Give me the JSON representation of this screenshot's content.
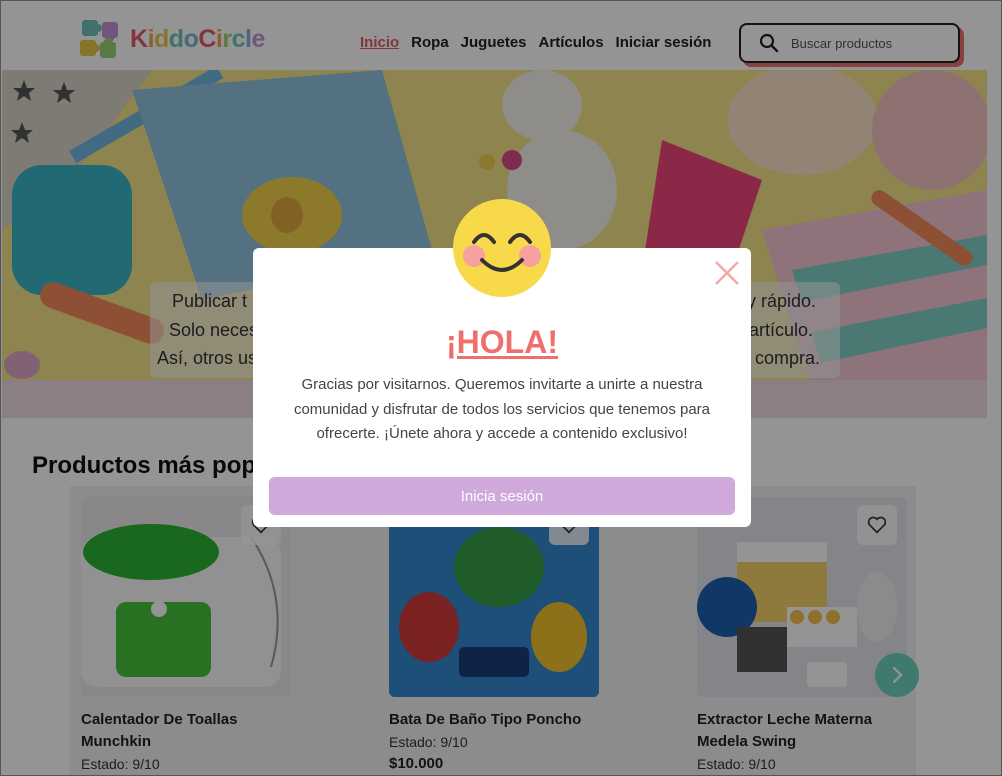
{
  "brand": {
    "name_parts": [
      "K",
      "i",
      "d",
      "d",
      "o",
      "C",
      "i",
      "r",
      "c",
      "l",
      "e"
    ],
    "colors": [
      "#e45a6a",
      "#f0a24a",
      "#e7c84a",
      "#6fc3b8",
      "#7ab3d9",
      "#e45a6a",
      "#f0a24a",
      "#9ad07a",
      "#6fc3b8",
      "#7ab3d9",
      "#c493d6"
    ]
  },
  "nav": {
    "items": [
      {
        "label": "Inicio",
        "active": true
      },
      {
        "label": "Ropa",
        "active": false
      },
      {
        "label": "Juguetes",
        "active": false
      },
      {
        "label": "Artículos",
        "active": false
      },
      {
        "label": "Iniciar sesión",
        "active": false
      }
    ]
  },
  "search": {
    "placeholder": "Buscar productos",
    "icon": "search-icon"
  },
  "hero": {
    "lines_left": [
      "Publicar t",
      "Solo neces",
      "Así, otros us"
    ],
    "lines_right": [
      "y rápido.",
      "artículo.",
      "a compra."
    ]
  },
  "popular": {
    "title": "Productos más popu",
    "products": [
      {
        "name": "Calentador De Toallas Munchkin",
        "state": "Estado: 9/10",
        "price": ""
      },
      {
        "name": "Bata De Baño Tipo Poncho",
        "state": "Estado: 9/10",
        "price": "$10.000"
      },
      {
        "name": "Extractor Leche Materna Medela Swing",
        "state": "Estado: 9/10",
        "price": ""
      }
    ],
    "next_icon": "chevron-right-icon"
  },
  "modal": {
    "title": "¡HOLA!",
    "text": "Gracias por visitarnos. Queremos invitarte a unirte a nuestra comunidad y disfrutar de todos los servicios que tenemos para ofrecerte. ¡Únete ahora y accede a contenido exclusivo!",
    "button_label": "Inicia sesión",
    "close_icon": "close-icon",
    "emoji": "smiley-icon"
  },
  "colors": {
    "accent": "#ef6f6c",
    "button": "#cfa9dc",
    "teal": "#6fd0bd"
  }
}
